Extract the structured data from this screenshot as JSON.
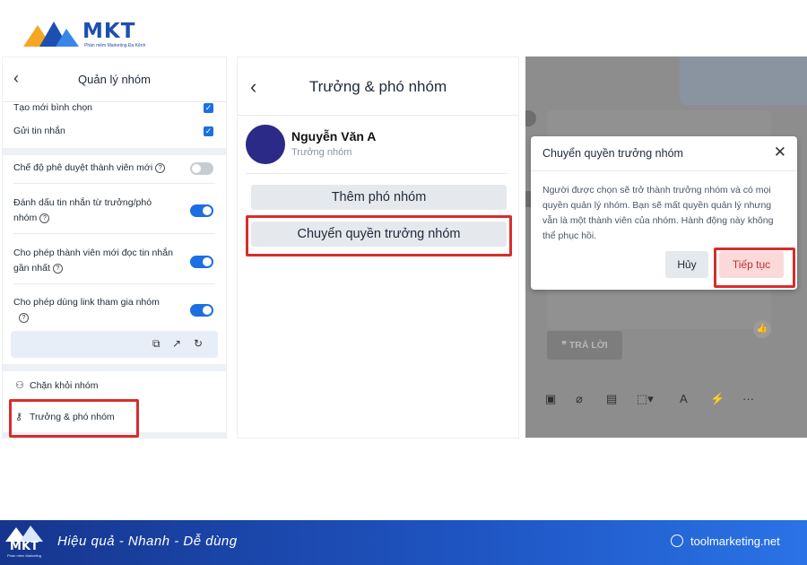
{
  "logo": {
    "text": "MKT",
    "subtitle": "Phần mềm Marketing Đa Kênh"
  },
  "panel1": {
    "back_icon": "chevron-left-icon",
    "title": "Quản lý nhóm",
    "rows_checkbox": [
      {
        "label": "Tạo mới bình chọn",
        "checked": true
      },
      {
        "label": "Gửi tin nhắn",
        "checked": true
      }
    ],
    "toggles": [
      {
        "label": "Chế độ phê duyệt thành viên mới",
        "on": false
      },
      {
        "label": "Đánh dấu tin nhắn từ trưởng/phó nhóm",
        "on": true
      },
      {
        "label": "Cho phép thành viên mới đọc tin nhắn gần nhất",
        "on": true
      },
      {
        "label": "Cho phép dùng link tham gia nhóm",
        "on": true
      }
    ],
    "menu": [
      {
        "label": "Chặn khỏi nhóm",
        "icon": "user-block-icon"
      },
      {
        "label": "Trưởng & phó nhóm",
        "icon": "key-icon"
      }
    ]
  },
  "panel2": {
    "title": "Trưởng & phó nhóm",
    "user_name": "Nguyễn Văn A",
    "user_role": "Trưởng nhóm",
    "add_deputy": "Thêm phó nhóm",
    "transfer_owner": "Chuyển quyền trưởng nhóm"
  },
  "panel3": {
    "reply_label": "TRẢ LỜI",
    "toolbar_icons": [
      "image-icon",
      "attach-icon",
      "contact-card-icon",
      "screenshot-icon",
      "format-icon",
      "quick-message-icon",
      "more-icon"
    ]
  },
  "dialog": {
    "title": "Chuyển quyền trưởng nhóm",
    "body": "Người được chọn sẽ trở thành trưởng nhóm và có mọi quyền quản lý nhóm. Bạn sẽ mất quyền quản lý nhưng vẫn là một thành viên của nhóm. Hành động này không thể phục hồi.",
    "cancel": "Hủy",
    "continue": "Tiếp tục"
  },
  "footer": {
    "logo": "MKT",
    "logo_sub": "Phần mềm Marketing",
    "slogan": "Hiệu quả - Nhanh  - Dễ dùng",
    "url": "toolmarketing.net"
  },
  "colors": {
    "primary": "#1b6fe0",
    "highlight": "#d92c2c",
    "avatar": "#2b2a86",
    "footer": "#1f56c4"
  }
}
